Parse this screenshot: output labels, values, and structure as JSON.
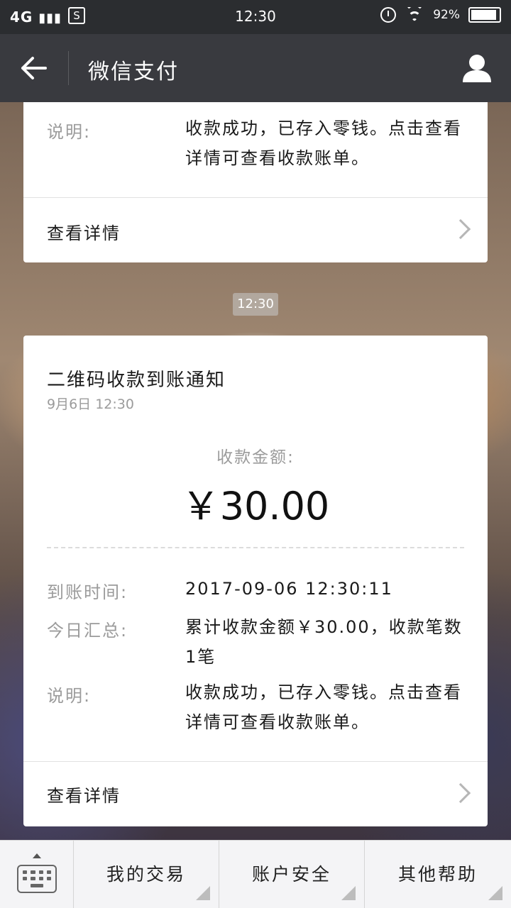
{
  "status_bar": {
    "network": "4G",
    "sim_icon": "S",
    "time": "12:30",
    "battery": "92%"
  },
  "nav": {
    "title": "微信支付"
  },
  "card_partial": {
    "desc_label": "说明:",
    "desc_value": "收款成功，已存入零钱。点击查看详情可查看收款账单。",
    "details_link": "查看详情"
  },
  "chat_timestamp": "12:30",
  "card_notice": {
    "title": "二维码收款到账通知",
    "date": "9月6日  12:30",
    "amount_label": "收款金额:",
    "amount": "￥30.00",
    "arrival_label": "到账时间:",
    "arrival_value": "2017-09-06 12:30:11",
    "summary_label": "今日汇总:",
    "summary_value": "累计收款金额￥30.00，收款笔数1笔",
    "desc_label": "说明:",
    "desc_value": "收款成功，已存入零钱。点击查看详情可查看收款账单。",
    "details_link": "查看详情"
  },
  "bottom_menu": {
    "items": [
      {
        "label": "我的交易"
      },
      {
        "label": "账户安全"
      },
      {
        "label": "其他帮助"
      }
    ]
  }
}
